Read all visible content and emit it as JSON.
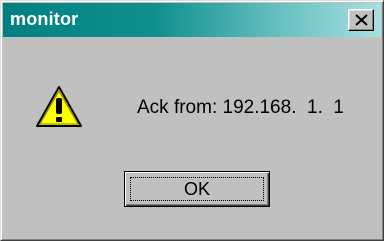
{
  "window": {
    "title": "monitor"
  },
  "titlebar": {
    "close_icon": "close-icon",
    "close_glyph": "×"
  },
  "dialog": {
    "icon": "warning-icon",
    "message": "Ack from: 192.168.  1.  1"
  },
  "buttons": {
    "ok_label": "OK"
  },
  "colors": {
    "titlebar_start": "#008080",
    "titlebar_end": "#a8e0e0",
    "dialog_background": "#c0c0c0",
    "warning_fill": "#ffff00"
  }
}
